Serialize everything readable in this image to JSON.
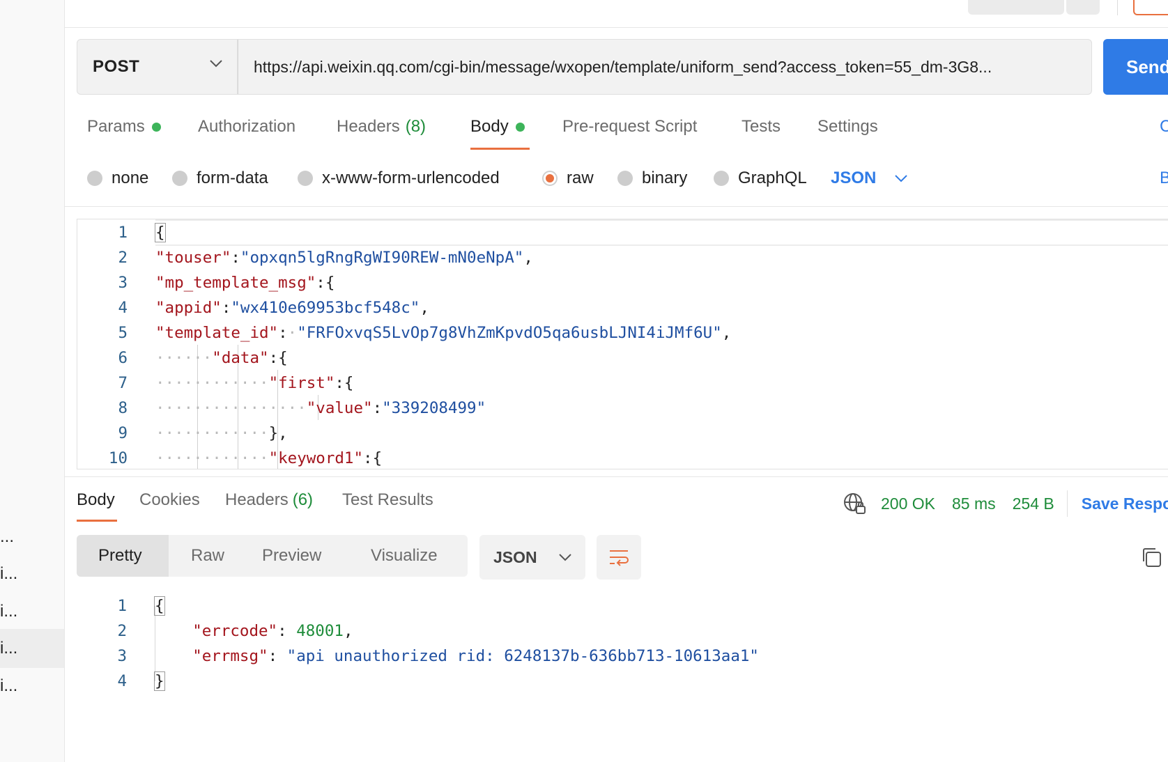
{
  "sidebar": {
    "items": [
      {
        "label": "..."
      },
      {
        "label": "i..."
      },
      {
        "label": "i..."
      },
      {
        "label": "i...",
        "active": true
      },
      {
        "label": "i..."
      }
    ]
  },
  "request": {
    "method": "POST",
    "url": "https://api.weixin.qq.com/cgi-bin/message/wxopen/template/uniform_send?access_token=55_dm-3G8...",
    "send_label": "Send",
    "tabs": [
      {
        "label": "Params",
        "dot": true
      },
      {
        "label": "Authorization"
      },
      {
        "label": "Headers",
        "count": "(8)"
      },
      {
        "label": "Body",
        "dot": true,
        "active": true
      },
      {
        "label": "Pre-request Script"
      },
      {
        "label": "Tests"
      },
      {
        "label": "Settings"
      }
    ],
    "cookies_label": "Cookies",
    "body_modes": [
      "none",
      "form-data",
      "x-www-form-urlencoded",
      "raw",
      "binary",
      "GraphQL"
    ],
    "selected_mode": "raw",
    "format": "JSON",
    "beautify_label": "Beautify",
    "body_lines": [
      "1",
      "2",
      "3",
      "4",
      "5",
      "6",
      "7",
      "8",
      "9",
      "10"
    ]
  },
  "response": {
    "tabs": [
      {
        "label": "Body",
        "active": true
      },
      {
        "label": "Cookies"
      },
      {
        "label": "Headers",
        "count": "(6)"
      },
      {
        "label": "Test Results"
      }
    ],
    "status": "200 OK",
    "time": "85 ms",
    "size": "254 B",
    "save_label": "Save Response",
    "views": [
      "Pretty",
      "Raw",
      "Preview",
      "Visualize"
    ],
    "active_view": "Pretty",
    "format": "JSON",
    "body_lines": [
      "1",
      "2",
      "3",
      "4"
    ]
  },
  "colors": {
    "accent": "#e9703f",
    "primary": "#2f7be6",
    "success": "#1e8c3a",
    "json_key": "#a3151d",
    "json_string": "#1f4fa0"
  }
}
